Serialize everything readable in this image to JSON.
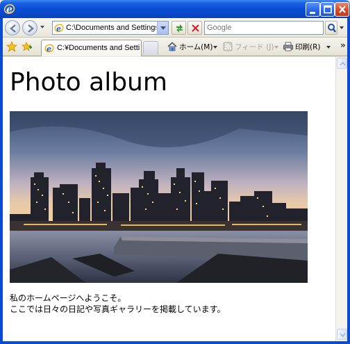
{
  "address": {
    "url": "C:\\Documents and Settings\\F"
  },
  "search": {
    "placeholder": "Google"
  },
  "tab": {
    "label": "C:¥Documents and Settin..."
  },
  "commands": {
    "home": "ホーム(M)",
    "feed": "フィード (J)",
    "print": "印刷(R)"
  },
  "page": {
    "title": "Photo album",
    "lines": [
      "私のホームページへようこそ。",
      "ここでは日々の日記や写真ギャラリーを掲載しています。"
    ]
  },
  "colors": {
    "titlebar": "#0a4fd8",
    "close_button": "#d8492a",
    "refresh_icon": "#2e9a2e",
    "stop_icon": "#d02020"
  },
  "icons": [
    "ie-logo-icon",
    "minimize-icon",
    "maximize-icon",
    "close-icon",
    "back-icon",
    "forward-icon",
    "page-icon",
    "refresh-icon",
    "stop-icon",
    "search-icon",
    "favorites-star-icon",
    "add-favorites-icon",
    "home-icon",
    "feed-icon",
    "printer-icon"
  ]
}
